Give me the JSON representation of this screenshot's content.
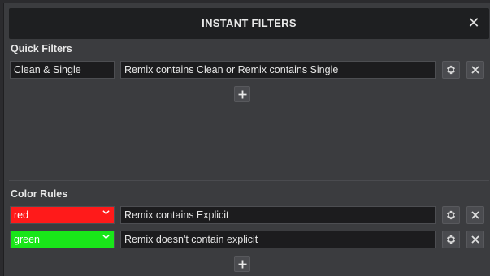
{
  "dialog": {
    "title": "INSTANT FILTERS",
    "close_glyph": "✕"
  },
  "quick_filters": {
    "heading": "Quick Filters",
    "rows": [
      {
        "name": "Clean & Single",
        "expression": "Remix contains Clean or Remix contains Single"
      }
    ],
    "add_glyph": "+"
  },
  "color_rules": {
    "heading": "Color Rules",
    "rows": [
      {
        "color": "red",
        "swatch": "#ff1a1a",
        "expression": "Remix contains Explicit"
      },
      {
        "color": "green",
        "swatch": "#19e619",
        "expression": "Remix doesn't contain explicit"
      }
    ],
    "add_glyph": "+"
  },
  "icons": {
    "settings": "gear-icon",
    "remove": "close-icon",
    "add": "plus-icon",
    "dropdown": "chevron-down-icon"
  }
}
